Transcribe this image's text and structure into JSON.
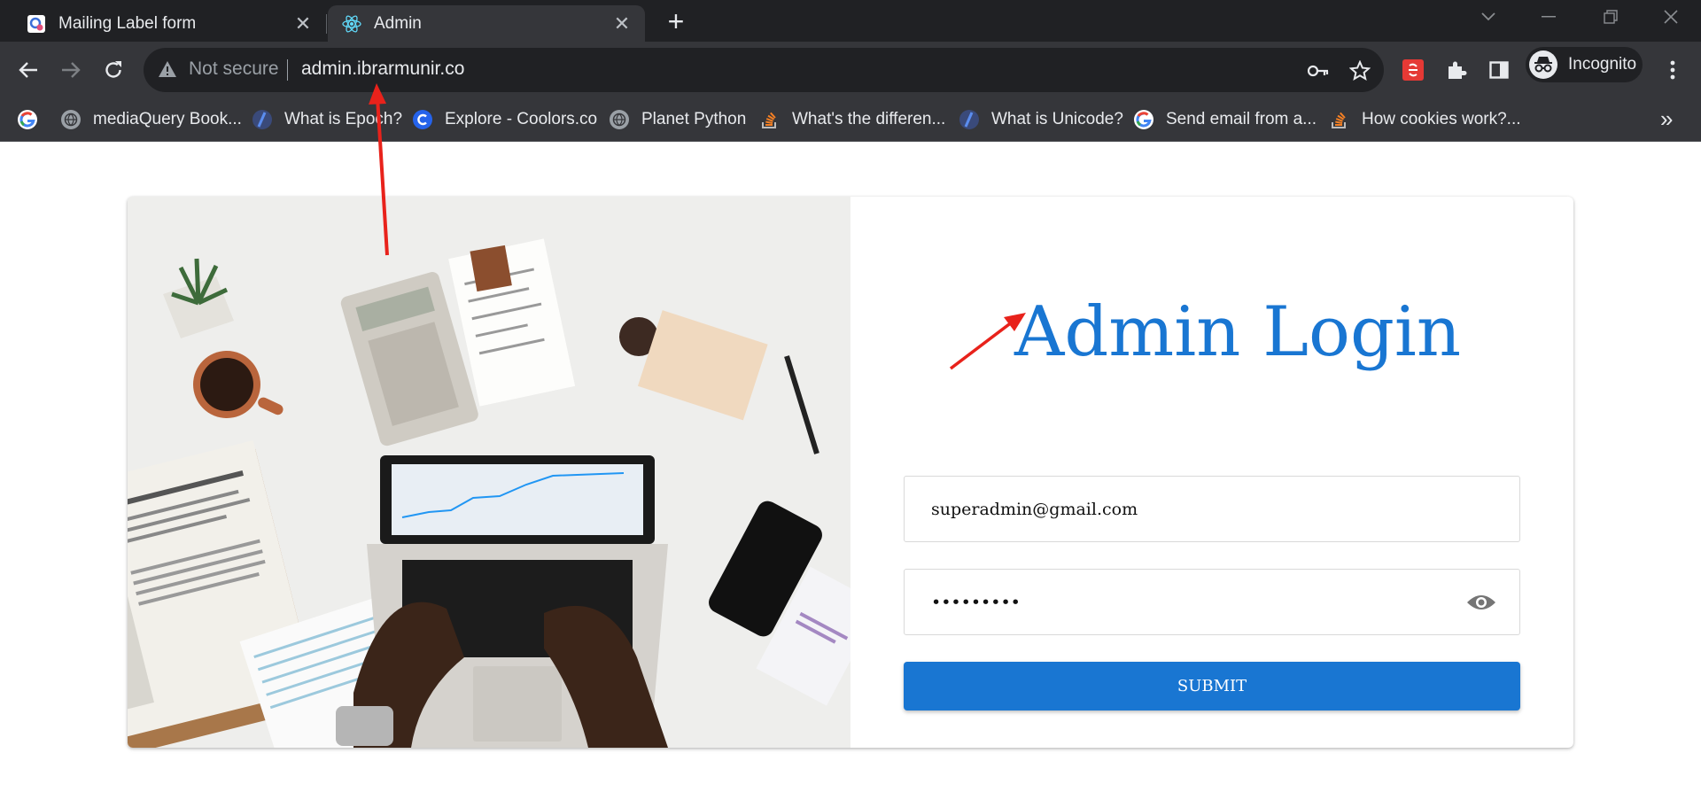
{
  "browser": {
    "tabs": [
      {
        "title": "Mailing Label form",
        "active": false
      },
      {
        "title": "Admin",
        "active": true
      }
    ],
    "new_tab_symbol": "+",
    "security_label": "Not secure",
    "url": "admin.ibrarmunir.co",
    "profile_label": "Incognito",
    "bookmarks": [
      {
        "label": "mediaQuery Book...",
        "icon": "globe-icon"
      },
      {
        "label": "What is Epoch?",
        "icon": "blog-icon"
      },
      {
        "label": "Explore - Coolors.co",
        "icon": "coolors-icon"
      },
      {
        "label": "Planet Python",
        "icon": "globe-icon"
      },
      {
        "label": "What's the differen...",
        "icon": "stackoverflow-icon"
      },
      {
        "label": "What is Unicode?",
        "icon": "blog-icon"
      },
      {
        "label": "Send email from a...",
        "icon": "google-icon"
      },
      {
        "label": "How cookies work?...",
        "icon": "stackoverflow-icon"
      }
    ],
    "bookmarks_overflow_symbol": "»"
  },
  "login": {
    "title": "Admin Login",
    "email_value": "superadmin@gmail.com",
    "password_value": "aaaaaaaaa",
    "submit_label": "SUBMIT"
  },
  "colors": {
    "accent": "#1976d2",
    "annotation_arrow": "#e8221b",
    "chrome_dark": "#202124",
    "chrome_toolbar": "#35363a"
  }
}
